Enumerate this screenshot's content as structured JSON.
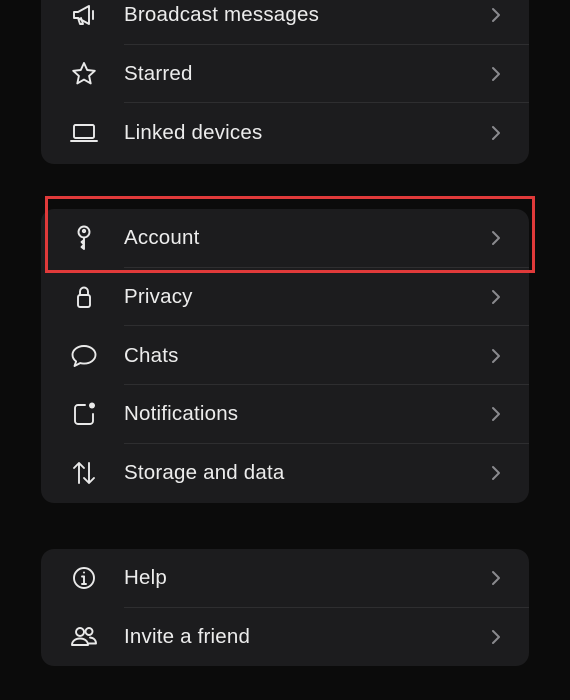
{
  "groups": [
    {
      "items": [
        {
          "label": "Broadcast messages",
          "icon": "megaphone-icon"
        },
        {
          "label": "Starred",
          "icon": "star-icon"
        },
        {
          "label": "Linked devices",
          "icon": "laptop-icon"
        }
      ]
    },
    {
      "items": [
        {
          "label": "Account",
          "icon": "key-icon"
        },
        {
          "label": "Privacy",
          "icon": "lock-icon"
        },
        {
          "label": "Chats",
          "icon": "chat-bubble-icon"
        },
        {
          "label": "Notifications",
          "icon": "notification-icon"
        },
        {
          "label": "Storage and data",
          "icon": "up-down-arrows-icon"
        }
      ]
    },
    {
      "items": [
        {
          "label": "Help",
          "icon": "info-icon"
        },
        {
          "label": "Invite a friend",
          "icon": "people-icon"
        }
      ]
    }
  ],
  "highlight": {
    "target": "Account",
    "color": "#e03a3a"
  },
  "colors": {
    "background": "#0b0b0b",
    "group_bg": "#1c1c1e",
    "chevron": "#8a8a8e",
    "text": "#ececec"
  }
}
